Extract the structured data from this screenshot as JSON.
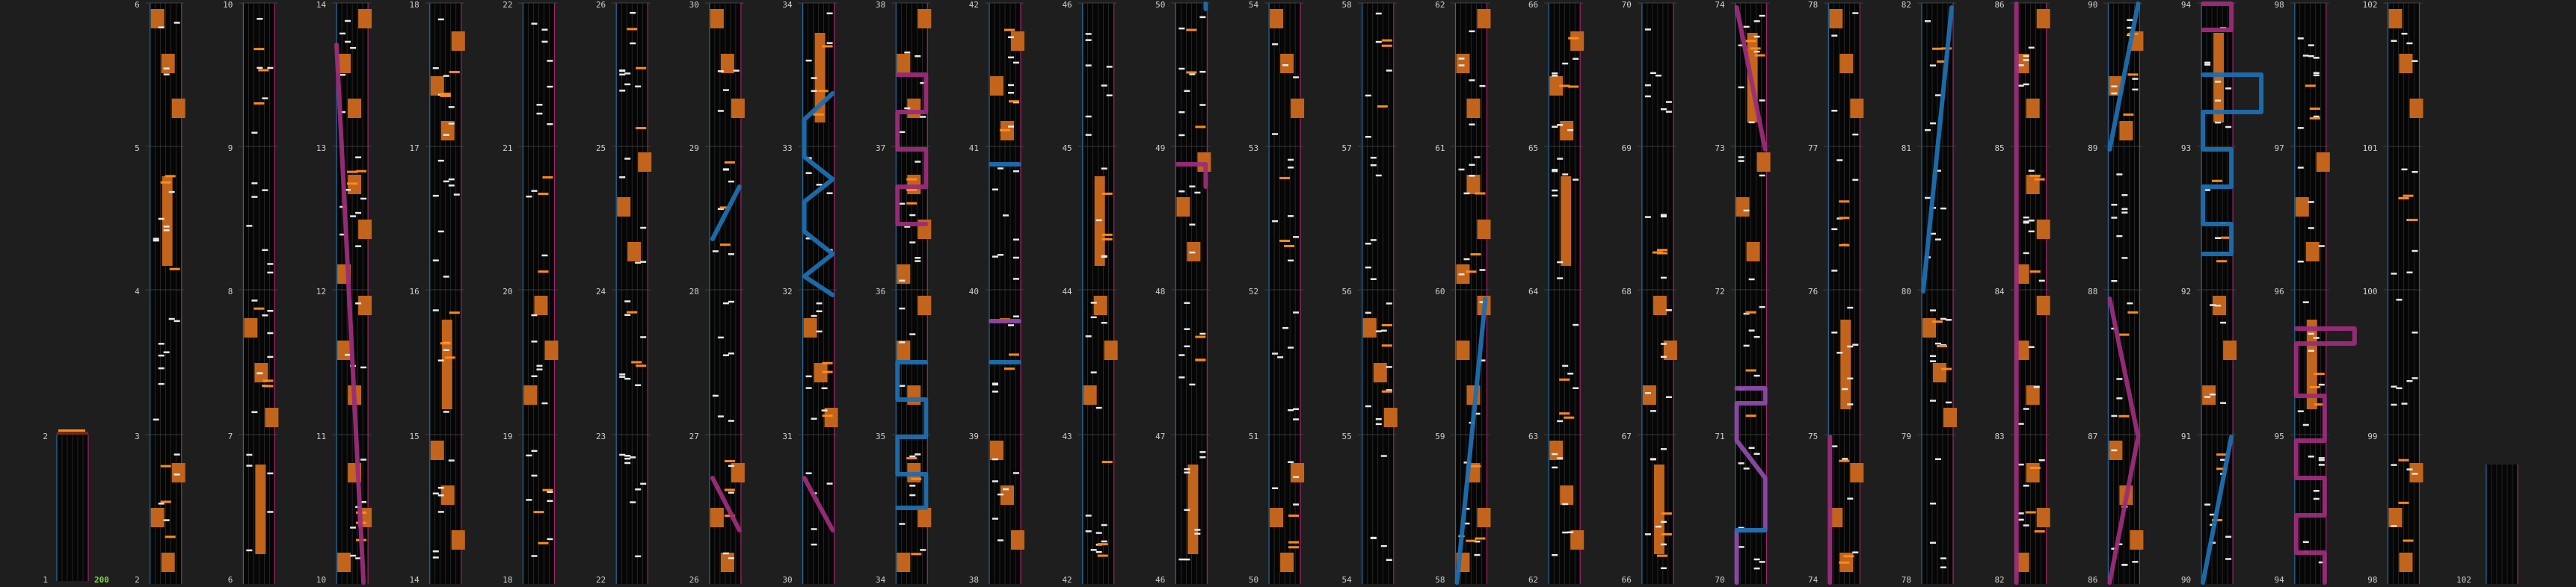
{
  "chart_title": "",
  "combo_count": "200",
  "colors": {
    "background": "#1e1e1e",
    "lane_bg": "#060606",
    "lane_line": "#3a3a3a",
    "lane_border_left": "#1f6fa3",
    "lane_border_right": "#a3246c",
    "tap_note": "#e9e9e9",
    "flick_note": "#ff8a1a",
    "hold_block": "#c2641b",
    "slide_blue": "#1d6fb0",
    "slide_magenta": "#9c2c7a",
    "slide_purple": "#8e4aa8",
    "measure_number": "#cfcfcf",
    "combo_text": "#7ddc3a"
  },
  "measure_labels": {
    "col_1": [
      "",
      "",
      "",
      "2",
      "1"
    ],
    "col_2": [
      "6",
      "5",
      "4",
      "3",
      "2"
    ],
    "col_3": [
      "10",
      "9",
      "8",
      "7",
      "6"
    ],
    "col_4": [
      "14",
      "13",
      "12",
      "11",
      "10"
    ],
    "col_5": [
      "18",
      "17",
      "16",
      "15",
      "14"
    ],
    "col_6": [
      "22",
      "21",
      "20",
      "19",
      "18"
    ],
    "col_7": [
      "26",
      "25",
      "24",
      "23",
      "22"
    ],
    "col_8": [
      "30",
      "29",
      "28",
      "27",
      "26"
    ],
    "col_9": [
      "34",
      "33",
      "32",
      "31",
      "30"
    ],
    "col_10": [
      "38",
      "37",
      "36",
      "35",
      "34"
    ],
    "col_11": [
      "42",
      "41",
      "40",
      "39",
      "38"
    ],
    "col_12": [
      "46",
      "45",
      "44",
      "43",
      "42"
    ],
    "col_13": [
      "50",
      "49",
      "48",
      "47",
      "46"
    ],
    "col_14": [
      "54",
      "53",
      "52",
      "51",
      "50"
    ],
    "col_15": [
      "58",
      "57",
      "56",
      "55",
      "54"
    ],
    "col_16": [
      "62",
      "61",
      "60",
      "59",
      "58"
    ],
    "col_17": [
      "66",
      "65",
      "64",
      "63",
      "62"
    ],
    "col_18": [
      "70",
      "69",
      "68",
      "67",
      "66"
    ],
    "col_19": [
      "74",
      "73",
      "72",
      "71",
      "70"
    ],
    "col_20": [
      "78",
      "77",
      "76",
      "75",
      "74"
    ],
    "col_21": [
      "82",
      "81",
      "80",
      "79",
      "78"
    ],
    "col_22": [
      "86",
      "85",
      "84",
      "83",
      "82"
    ],
    "col_23": [
      "90",
      "89",
      "88",
      "87",
      "86"
    ],
    "col_24": [
      "94",
      "93",
      "92",
      "91",
      "90"
    ],
    "col_25": [
      "98",
      "97",
      "96",
      "95",
      "94"
    ],
    "col_26": [
      "102",
      "101",
      "100",
      "99",
      "98"
    ],
    "col_27": [
      "",
      "",
      "",
      "",
      "102"
    ]
  }
}
